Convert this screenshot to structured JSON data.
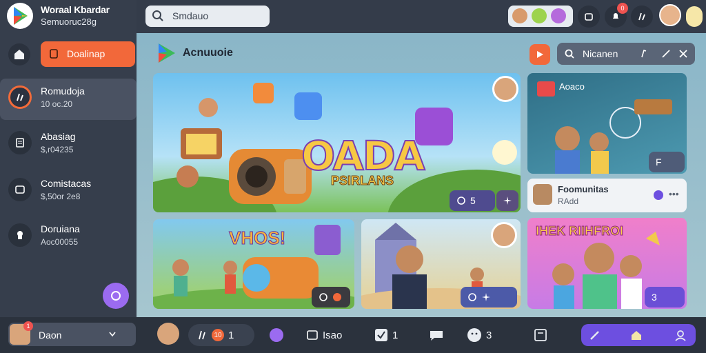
{
  "header": {
    "app_title": "Woraal Kbardar",
    "app_subtitle": "Semuoruc28g",
    "search_text": "Smdauo",
    "notification_count": "0"
  },
  "sidebar": {
    "primary_button": "Doalinap",
    "items": [
      {
        "label": "Romudoja",
        "sub": "10 oc.20"
      },
      {
        "label": "Abasiag",
        "sub": "$,r04235"
      },
      {
        "label": "Comistacas",
        "sub": "$,50or 2e8"
      },
      {
        "label": "Doruiana",
        "sub": "Aoc00055"
      }
    ]
  },
  "main": {
    "section_title": "Acnuuoie",
    "filter_text": "Nicanen",
    "hero": {
      "title": "OADA",
      "subtitle": "PSIRLANS",
      "pill_label": "5"
    },
    "side_card": {
      "title": "Aoaco",
      "pill_label": "F"
    },
    "info_card": {
      "title": "Foomunitas",
      "sub": "RAdd"
    },
    "card_b1": {
      "title": "VHOS!"
    },
    "card_b3": {
      "title": "IHEK RIIHFROI",
      "pill_label": "3"
    }
  },
  "bottombar": {
    "user_name": "Daon",
    "user_badge": "1",
    "item1_badge": "10",
    "item1_count": "1",
    "item2_label": "Isao",
    "item3_count": "1",
    "item4_count": "3"
  },
  "colors": {
    "accent": "#f2683a",
    "purple": "#6d4fe0",
    "topbar": "#343c4a"
  }
}
